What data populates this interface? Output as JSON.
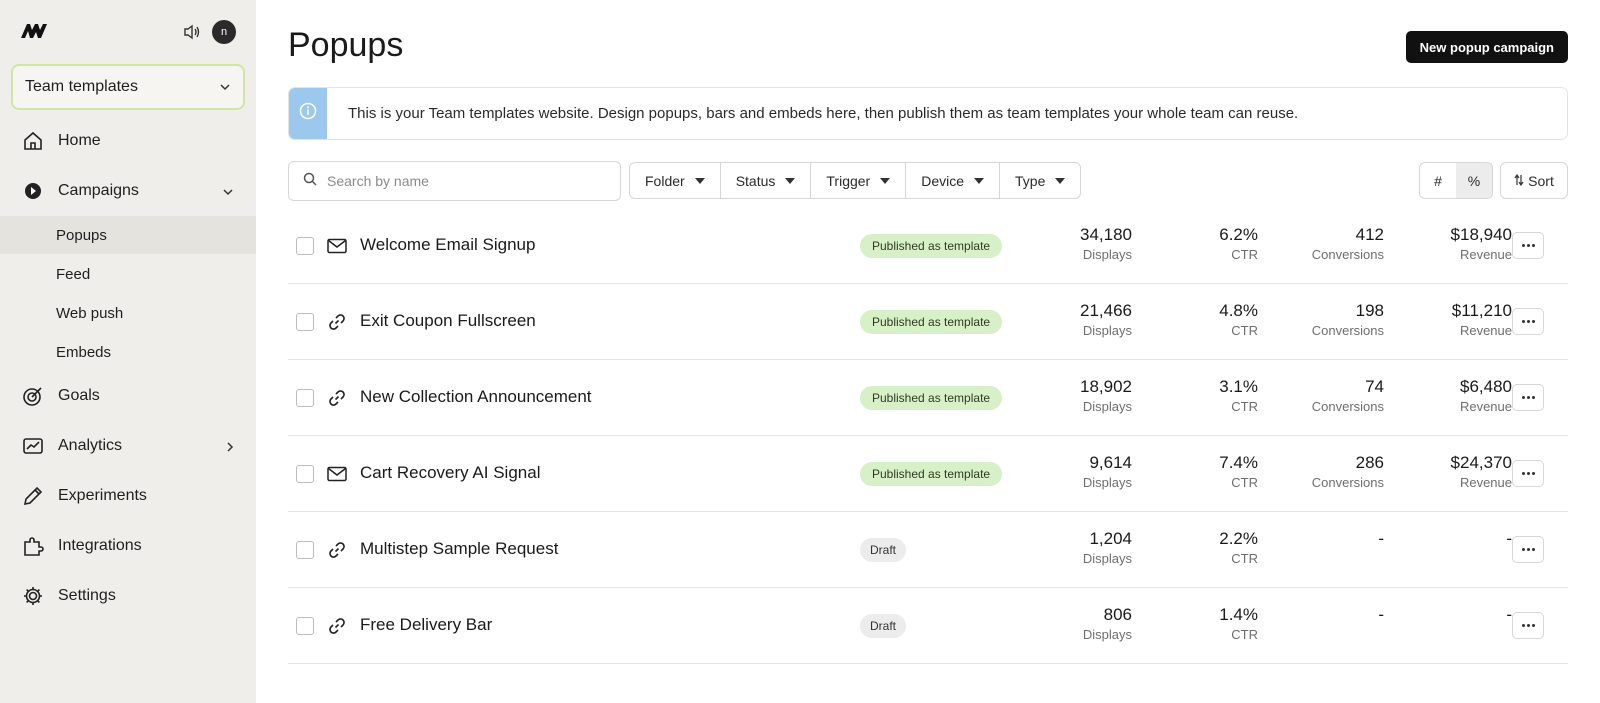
{
  "sidebar": {
    "avatar_initial": "n",
    "team_select": "Team templates",
    "nav": {
      "home": "Home",
      "campaigns": "Campaigns",
      "popups": "Popups",
      "feed": "Feed",
      "web_push": "Web push",
      "embeds": "Embeds",
      "goals": "Goals",
      "analytics": "Analytics",
      "experiments": "Experiments",
      "integrations": "Integrations",
      "settings": "Settings"
    }
  },
  "header": {
    "title": "Popups",
    "new_button": "New popup campaign"
  },
  "banner": {
    "text": "This is your Team templates website. Design popups, bars and embeds here, then publish them as team templates your whole team can reuse."
  },
  "toolbar": {
    "search_placeholder": "Search by name",
    "filters": [
      "Folder",
      "Status",
      "Trigger",
      "Device",
      "Type"
    ],
    "toggle_count": "#",
    "toggle_percent": "%",
    "sort": "Sort"
  },
  "rows": [
    {
      "icon": "mail-icon",
      "name": "Welcome Email Signup",
      "status": "Published as template",
      "displays": "34,180",
      "displays_label": "Displays",
      "ctr": "6.2%",
      "ctr_label": "CTR",
      "conversions": "412",
      "conversions_label": "Conversions",
      "revenue": "$18,940",
      "revenue_label": "Revenue"
    },
    {
      "icon": "link-icon",
      "name": "Exit Coupon Fullscreen",
      "status": "Published as template",
      "displays": "21,466",
      "displays_label": "Displays",
      "ctr": "4.8%",
      "ctr_label": "CTR",
      "conversions": "198",
      "conversions_label": "Conversions",
      "revenue": "$11,210",
      "revenue_label": "Revenue"
    },
    {
      "icon": "link-icon",
      "name": "New Collection Announcement",
      "status": "Published as template",
      "displays": "18,902",
      "displays_label": "Displays",
      "ctr": "3.1%",
      "ctr_label": "CTR",
      "conversions": "74",
      "conversions_label": "Conversions",
      "revenue": "$6,480",
      "revenue_label": "Revenue"
    },
    {
      "icon": "mail-icon",
      "name": "Cart Recovery AI Signal",
      "status": "Published as template",
      "displays": "9,614",
      "displays_label": "Displays",
      "ctr": "7.4%",
      "ctr_label": "CTR",
      "conversions": "286",
      "conversions_label": "Conversions",
      "revenue": "$24,370",
      "revenue_label": "Revenue"
    },
    {
      "icon": "link-icon",
      "name": "Multistep Sample Request",
      "status": "Draft",
      "displays": "1,204",
      "displays_label": "Displays",
      "ctr": "2.2%",
      "ctr_label": "CTR",
      "conversions": "-",
      "revenue": "-"
    },
    {
      "icon": "link-icon",
      "name": "Free Delivery Bar",
      "status": "Draft",
      "displays": "806",
      "displays_label": "Displays",
      "ctr": "1.4%",
      "ctr_label": "CTR",
      "conversions": "-",
      "revenue": "-"
    }
  ]
}
